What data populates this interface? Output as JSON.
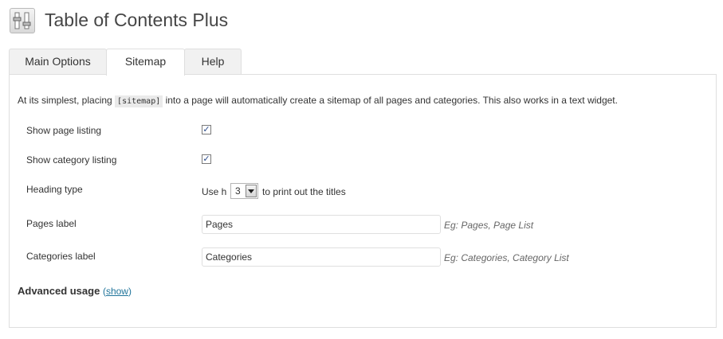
{
  "header": {
    "icon": "settings-sliders-icon",
    "title": "Table of Contents Plus"
  },
  "tabs": [
    {
      "label": "Main Options",
      "active": false
    },
    {
      "label": "Sitemap",
      "active": true
    },
    {
      "label": "Help",
      "active": false
    }
  ],
  "intro": {
    "before": "At its simplest, placing ",
    "code": "[sitemap]",
    "after": " into a page will automatically create a sitemap of all pages and categories. This also works in a text widget."
  },
  "settings": {
    "show_page_listing": {
      "label": "Show page listing",
      "checked": true
    },
    "show_category_listing": {
      "label": "Show category listing",
      "checked": true
    },
    "heading_type": {
      "label": "Heading type",
      "prefix": "Use h",
      "value": "3",
      "suffix": "to print out the titles"
    },
    "pages_label": {
      "label": "Pages label",
      "value": "Pages",
      "hint": "Eg: Pages, Page List"
    },
    "categories_label": {
      "label": "Categories label",
      "value": "Categories",
      "hint": "Eg: Categories, Category List"
    }
  },
  "advanced": {
    "label": "Advanced usage",
    "open_paren": "(",
    "link": "show",
    "close_paren": ")"
  },
  "colors": {
    "link": "#21759b",
    "border": "#dfdfdf",
    "tab_inactive": "#f1f1f1"
  }
}
